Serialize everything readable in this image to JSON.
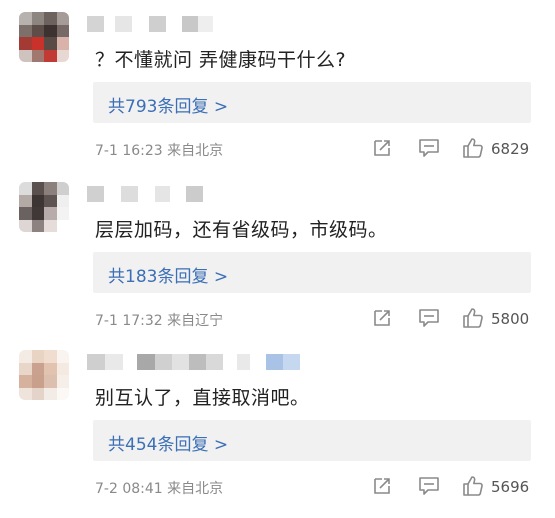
{
  "comments": [
    {
      "text": "？不懂就问 弄健康码干什么?",
      "replies_label": "共793条回复 >",
      "time": "7-1 16:23",
      "location": "来自北京",
      "likes": "6829",
      "avatar_colors": [
        "#b8b2ae",
        "#8d8580",
        "#6e625f",
        "#a59c97",
        "#7d6f6a",
        "#5d4e4a",
        "#3d3230",
        "#776a66",
        "#a33a34",
        "#c9312b",
        "#5a4a45",
        "#d9b2a9",
        "#cfc3bf",
        "#a07870",
        "#c23a34",
        "#e7d8d3"
      ],
      "username_blocks": [
        "#d4d4d4",
        "#ffffff",
        "#e6e6e6",
        "#ffffff",
        "#cfcfcf",
        "#ffffff",
        "#c8c8c8",
        "#eeeeee"
      ],
      "username_widths": [
        17,
        11,
        17,
        17,
        17,
        16,
        16,
        15
      ]
    },
    {
      "text": "层层加码，还有省级码，市级码。",
      "replies_label": "共183条回复 >",
      "time": "7-1 17:32",
      "location": "来自辽宁",
      "likes": "5800",
      "avatar_colors": [
        "#dcdcdc",
        "#5a514e",
        "#8b807c",
        "#cfcfcf",
        "#b3aaa6",
        "#3d3533",
        "#5e5552",
        "#efefef",
        "#6a6260",
        "#3f3836",
        "#b8acaa",
        "#f3f3f3",
        "#ddd6d4",
        "#8d8280",
        "#e6dcda",
        "#ffffff"
      ],
      "username_blocks": [
        "#d0d0d0",
        "#ffffff",
        "#dddddd",
        "#ffffff",
        "#e5e5e5",
        "#ffffff",
        "#cccccc"
      ],
      "username_widths": [
        17,
        17,
        17,
        17,
        15,
        16,
        17
      ]
    },
    {
      "text": "别互认了，直接取消吧。",
      "replies_label": "共454条回复 >",
      "time": "7-2 08:41",
      "location": "来自北京",
      "likes": "5696",
      "avatar_colors": [
        "#f4ece4",
        "#e9d3c2",
        "#f1ddd0",
        "#faf4f0",
        "#e8d6c8",
        "#c9a18e",
        "#e2c3b0",
        "#f5eae2",
        "#d6b29e",
        "#c8a08c",
        "#dcbfae",
        "#f6efe9",
        "#efe4dc",
        "#e4d3c8",
        "#f3ebe5",
        "#fbf8f5"
      ],
      "username_blocks": [
        "#cfcfcf",
        "#e9e9e9",
        "#ffffff",
        "#a8a8a8",
        "#d0d0d0",
        "#e2e2e2",
        "#bdbdbd",
        "#d9d9d9",
        "#ffffff",
        "#e9e9e9",
        "#ffffff",
        "#a9c3e6",
        "#c6d8f0"
      ],
      "username_widths": [
        18,
        18,
        14,
        18,
        17,
        17,
        17,
        17,
        14,
        13,
        16,
        17,
        17
      ]
    }
  ],
  "icons": {
    "share": "share-icon",
    "reply": "comment-icon",
    "like": "thumbs-up-icon"
  }
}
